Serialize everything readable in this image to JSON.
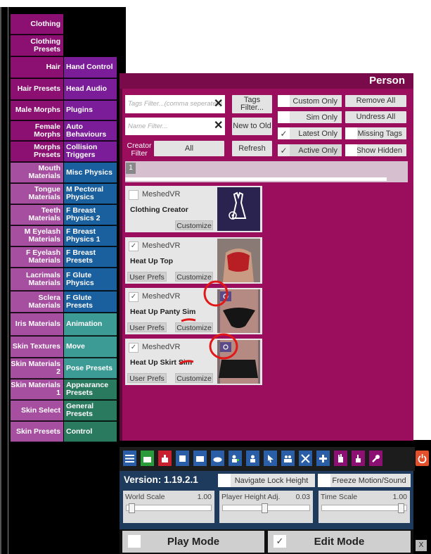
{
  "left_tabs": [
    {
      "label": "Clothing",
      "color": "#8c0f72"
    },
    {
      "label": "Clothing Presets",
      "color": "#8c0f72"
    },
    {
      "label": "Hair",
      "color": "#8c0f72"
    },
    {
      "label": "Hair Presets",
      "color": "#8c0f72"
    },
    {
      "label": "Male Morphs",
      "color": "#8c0f72"
    },
    {
      "label": "Female Morphs",
      "color": "#8c0f72"
    },
    {
      "label": "Morphs Presets",
      "color": "#8c0f72"
    },
    {
      "label": "Mouth Materials",
      "color": "#a64ea0"
    },
    {
      "label": "Tongue Materials",
      "color": "#a64ea0"
    },
    {
      "label": "Teeth Materials",
      "color": "#a64ea0"
    },
    {
      "label": "M Eyelash Materials",
      "color": "#a64ea0"
    },
    {
      "label": "F Eyelash Materials",
      "color": "#a64ea0"
    },
    {
      "label": "Lacrimals Materials",
      "color": "#a64ea0"
    },
    {
      "label": "Sclera Materials",
      "color": "#a64ea0"
    },
    {
      "label": "Iris Materials",
      "color": "#a64ea0"
    },
    {
      "label": "Skin Textures",
      "color": "#a64ea0"
    },
    {
      "label": "Skin Materials 2",
      "color": "#a64ea0"
    },
    {
      "label": "Skin Materials 1",
      "color": "#a64ea0"
    },
    {
      "label": "Skin Select",
      "color": "#a64ea0"
    },
    {
      "label": "Skin Presets",
      "color": "#a64ea0"
    }
  ],
  "right_tabs": [
    {
      "label": "Hand Control",
      "color": "#7b1d99"
    },
    {
      "label": "Head Audio",
      "color": "#7b1d99"
    },
    {
      "label": "Plugins",
      "color": "#7b1d99"
    },
    {
      "label": "Auto Behaviours",
      "color": "#7b1d99"
    },
    {
      "label": "Collision Triggers",
      "color": "#7b1d99"
    },
    {
      "label": "Misc Physics",
      "color": "#1a5f9e"
    },
    {
      "label": "M Pectoral Physics",
      "color": "#1a5f9e"
    },
    {
      "label": "F Breast Physics 2",
      "color": "#1a5f9e"
    },
    {
      "label": "F Breast Physics 1",
      "color": "#1a5f9e"
    },
    {
      "label": "F Breast Presets",
      "color": "#1a5f9e"
    },
    {
      "label": "F Glute Physics",
      "color": "#1a5f9e"
    },
    {
      "label": "F Glute Presets",
      "color": "#1a5f9e"
    },
    {
      "label": "Animation",
      "color": "#3c9b95"
    },
    {
      "label": "Move",
      "color": "#3c9b95"
    },
    {
      "label": "Pose Presets",
      "color": "#3c9b95"
    },
    {
      "label": "Appearance Presets",
      "color": "#2a7a60"
    },
    {
      "label": "General Presets",
      "color": "#2a7a60"
    },
    {
      "label": "Control",
      "color": "#2a7a60"
    }
  ],
  "panel": {
    "title": "Person",
    "tags_filter_placeholder": "Tags Filter...(comma seperated)",
    "tags_filter_button": "Tags Filter...",
    "name_filter_placeholder": "Name Filter...",
    "sort_button": "New to Old",
    "creator_filter_label": "Creator Filter",
    "creator_filter_value": "All",
    "refresh_button": "Refresh",
    "toggles": {
      "custom_only": "Custom Only",
      "sim_only": "Sim Only",
      "latest_only": "Latest Only",
      "active_only": "Active Only",
      "remove_all": "Remove All",
      "undress_all": "Undress All",
      "missing_tags": "Missing Tags",
      "show_hidden": "Show Hidden"
    },
    "page_number": "1",
    "items": [
      {
        "creator": "MeshedVR",
        "name": "Clothing Creator",
        "checked": false,
        "buttons": [
          "Customize"
        ]
      },
      {
        "creator": "MeshedVR",
        "name": "Heat Up Top",
        "checked": true,
        "buttons": [
          "User Prefs",
          "Customize"
        ]
      },
      {
        "creator": "MeshedVR",
        "name": "Heat Up Panty Sim",
        "checked": true,
        "buttons": [
          "User Prefs",
          "Customize"
        ]
      },
      {
        "creator": "MeshedVR",
        "name": "Heat Up Skirt Sim",
        "checked": true,
        "buttons": [
          "User Prefs",
          "Customize"
        ]
      }
    ]
  },
  "bottom": {
    "version": "Version: 1.19.2.1",
    "navigate_lock_height": "Navigate Lock Height",
    "freeze_motion_sound": "Freeze Motion/Sound",
    "world_scale_label": "World Scale",
    "world_scale_value": "1.00",
    "player_height_label": "Player Height Adj.",
    "player_height_value": "0.03",
    "time_scale_label": "Time Scale",
    "time_scale_value": "1.00",
    "play_mode": "Play Mode",
    "edit_mode": "Edit Mode",
    "close": "X"
  },
  "toolbar_icons": [
    "menu-icon",
    "scene-icon",
    "power-icon",
    "box-icon",
    "package-icon",
    "cloud-icon",
    "person-add-icon",
    "person-icon",
    "cursor-icon",
    "people-icon",
    "tools-icon",
    "plus-icon",
    "hand-icon",
    "hand-pointer-icon",
    "wrench-icon",
    "power-off-icon"
  ],
  "colors": {
    "panel": "#9b0e5e",
    "info_panel": "#1e3a5c",
    "annotation": "#e01818"
  }
}
